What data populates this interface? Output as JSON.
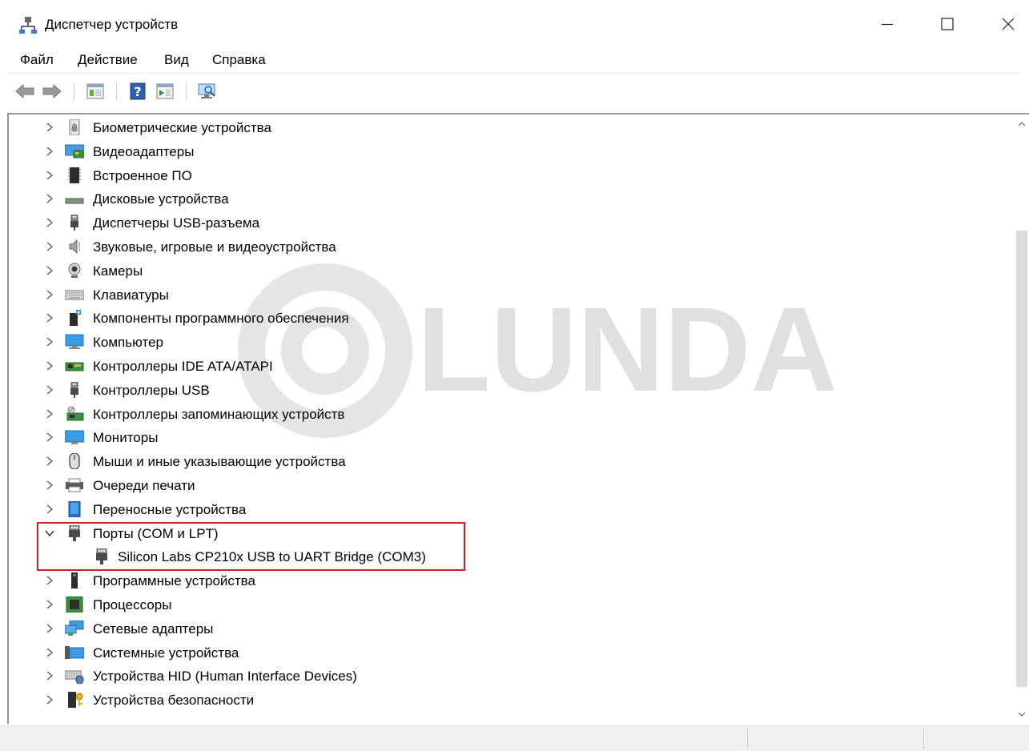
{
  "window": {
    "title": "Диспетчер устройств",
    "icon": "device-manager-icon",
    "controls": [
      "minimize-icon",
      "maximize-icon",
      "close-icon"
    ]
  },
  "menu": {
    "items": [
      "Файл",
      "Действие",
      "Вид",
      "Справка"
    ]
  },
  "toolbar": {
    "buttons": [
      "back-arrow-icon",
      "forward-arrow-icon",
      "properties-icon",
      "help-icon",
      "update-driver-icon",
      "scan-hardware-icon"
    ]
  },
  "tree": {
    "categories": [
      {
        "label": "Биометрические устройства",
        "icon": "fingerprint-icon",
        "expanded": false
      },
      {
        "label": "Видеоадаптеры",
        "icon": "display-adapter-icon",
        "expanded": false
      },
      {
        "label": "Встроенное ПО",
        "icon": "firmware-chip-icon",
        "expanded": false
      },
      {
        "label": "Дисковые устройства",
        "icon": "disk-drive-icon",
        "expanded": false
      },
      {
        "label": "Диспетчеры USB-разъема",
        "icon": "usb-plug-icon",
        "expanded": false
      },
      {
        "label": "Звуковые, игровые и видеоустройства",
        "icon": "speaker-icon",
        "expanded": false
      },
      {
        "label": "Камеры",
        "icon": "webcam-icon",
        "expanded": false
      },
      {
        "label": "Клавиатуры",
        "icon": "keyboard-icon",
        "expanded": false
      },
      {
        "label": "Компоненты программного обеспечения",
        "icon": "software-component-icon",
        "expanded": false
      },
      {
        "label": "Компьютер",
        "icon": "computer-icon",
        "expanded": false
      },
      {
        "label": "Контроллеры IDE ATA/ATAPI",
        "icon": "ide-controller-icon",
        "expanded": false
      },
      {
        "label": "Контроллеры USB",
        "icon": "usb-plug-icon",
        "expanded": false
      },
      {
        "label": "Контроллеры запоминающих устройств",
        "icon": "storage-controller-icon",
        "expanded": false
      },
      {
        "label": "Мониторы",
        "icon": "monitor-icon",
        "expanded": false
      },
      {
        "label": "Мыши и иные указывающие устройства",
        "icon": "mouse-icon",
        "expanded": false
      },
      {
        "label": "Очереди печати",
        "icon": "printer-icon",
        "expanded": false
      },
      {
        "label": "Переносные устройства",
        "icon": "portable-device-icon",
        "expanded": false
      },
      {
        "label": "Порты (COM и LPT)",
        "icon": "port-connector-icon",
        "expanded": true,
        "children": [
          {
            "label": "Silicon Labs CP210x USB to UART Bridge (COM3)",
            "icon": "port-connector-icon"
          }
        ]
      },
      {
        "label": "Программные устройства",
        "icon": "software-device-icon",
        "expanded": false
      },
      {
        "label": "Процессоры",
        "icon": "processor-icon",
        "expanded": false
      },
      {
        "label": "Сетевые адаптеры",
        "icon": "network-adapter-icon",
        "expanded": false
      },
      {
        "label": "Системные устройства",
        "icon": "system-devices-icon",
        "expanded": false
      },
      {
        "label": "Устройства HID (Human Interface Devices)",
        "icon": "hid-device-icon",
        "expanded": false
      },
      {
        "label": "Устройства безопасности",
        "icon": "security-device-icon",
        "expanded": false
      }
    ]
  },
  "watermark": {
    "text": "LUNDA"
  },
  "colors": {
    "highlight_border": "#d11f26",
    "accent_blue": "#1e7fd9"
  }
}
